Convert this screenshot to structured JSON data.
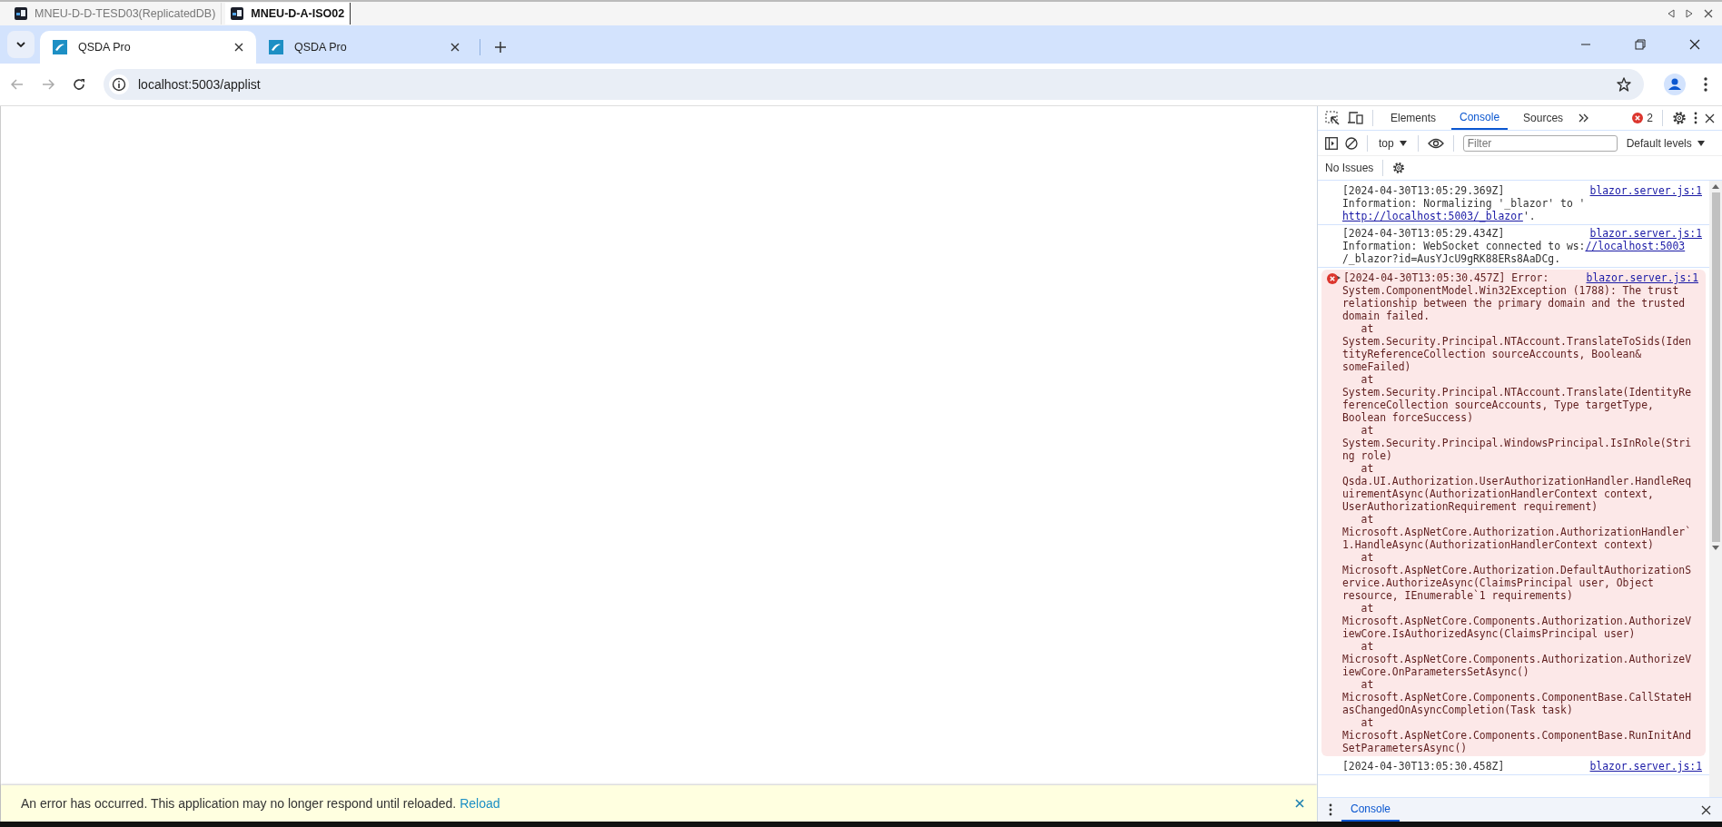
{
  "remote_tabs": [
    {
      "label": "MNEU-D-D-TESD03(ReplicatedDB)",
      "selected": false
    },
    {
      "label": "MNEU-D-A-ISO02",
      "selected": true
    }
  ],
  "browser": {
    "tabs": [
      {
        "title": "QSDA Pro",
        "selected": true
      },
      {
        "title": "QSDA Pro",
        "selected": false
      }
    ],
    "address": "localhost:5003/applist"
  },
  "page": {
    "error_banner": {
      "message": "An error has occurred. This application may no longer respond until reloaded.",
      "link": "Reload"
    }
  },
  "devtools": {
    "tabs": [
      {
        "label": "Elements",
        "selected": false
      },
      {
        "label": "Console",
        "selected": true
      },
      {
        "label": "Sources",
        "selected": false
      }
    ],
    "error_count": "2",
    "context": "top",
    "filter_placeholder": "Filter",
    "levels": "Default levels",
    "issues": "No Issues",
    "messages": [
      {
        "kind": "info",
        "header": "[2024-04-30T13:05:29.369Z]",
        "source": "blazor.server.js:1",
        "lines": [
          [
            {
              "kind": "text",
              "text": "Information: Normalizing '_blazor' to '"
            }
          ],
          [
            {
              "kind": "link",
              "text": "http://localhost:5003/_blazor"
            },
            {
              "kind": "text",
              "text": "'."
            }
          ]
        ]
      },
      {
        "kind": "info",
        "header": "[2024-04-30T13:05:29.434Z]",
        "source": "blazor.server.js:1",
        "lines": [
          [
            {
              "kind": "text",
              "text": "Information: WebSocket connected to ws:"
            },
            {
              "kind": "link",
              "text": "//localhost:5003"
            }
          ],
          [
            {
              "kind": "text",
              "text": "/_blazor?id=AusYJcU9gRK88ERs8AaDCg."
            }
          ]
        ]
      },
      {
        "kind": "error",
        "expanded": false,
        "header": "[2024-04-30T13:05:30.457Z] Error:",
        "source": "blazor.server.js:1",
        "lines": [
          [
            {
              "kind": "text",
              "text": "System.ComponentModel.Win32Exception (1788): The trust"
            }
          ],
          [
            {
              "kind": "text",
              "text": "relationship between the primary domain and the trusted"
            }
          ],
          [
            {
              "kind": "text",
              "text": "domain failed."
            }
          ],
          [
            {
              "kind": "text",
              "text": "   at"
            }
          ],
          [
            {
              "kind": "text",
              "text": "System.Security.Principal.NTAccount.TranslateToSids(Iden"
            }
          ],
          [
            {
              "kind": "text",
              "text": "tityReferenceCollection sourceAccounts, Boolean&"
            }
          ],
          [
            {
              "kind": "text",
              "text": "someFailed)"
            }
          ],
          [
            {
              "kind": "text",
              "text": "   at"
            }
          ],
          [
            {
              "kind": "text",
              "text": "System.Security.Principal.NTAccount.Translate(IdentityRe"
            }
          ],
          [
            {
              "kind": "text",
              "text": "ferenceCollection sourceAccounts, Type targetType,"
            }
          ],
          [
            {
              "kind": "text",
              "text": "Boolean forceSuccess)"
            }
          ],
          [
            {
              "kind": "text",
              "text": "   at"
            }
          ],
          [
            {
              "kind": "text",
              "text": "System.Security.Principal.WindowsPrincipal.IsInRole(Stri"
            }
          ],
          [
            {
              "kind": "text",
              "text": "ng role)"
            }
          ],
          [
            {
              "kind": "text",
              "text": "   at"
            }
          ],
          [
            {
              "kind": "text",
              "text": "Qsda.UI.Authorization.UserAuthorizationHandler.HandleReq"
            }
          ],
          [
            {
              "kind": "text",
              "text": "uirementAsync(AuthorizationHandlerContext context,"
            }
          ],
          [
            {
              "kind": "text",
              "text": "UserAuthorizationRequirement requirement)"
            }
          ],
          [
            {
              "kind": "text",
              "text": "   at"
            }
          ],
          [
            {
              "kind": "text",
              "text": "Microsoft.AspNetCore.Authorization.AuthorizationHandler`"
            }
          ],
          [
            {
              "kind": "text",
              "text": "1.HandleAsync(AuthorizationHandlerContext context)"
            }
          ],
          [
            {
              "kind": "text",
              "text": "   at"
            }
          ],
          [
            {
              "kind": "text",
              "text": "Microsoft.AspNetCore.Authorization.DefaultAuthorizationS"
            }
          ],
          [
            {
              "kind": "text",
              "text": "ervice.AuthorizeAsync(ClaimsPrincipal user, Object"
            }
          ],
          [
            {
              "kind": "text",
              "text": "resource, IEnumerable`1 requirements)"
            }
          ],
          [
            {
              "kind": "text",
              "text": "   at"
            }
          ],
          [
            {
              "kind": "text",
              "text": "Microsoft.AspNetCore.Components.Authorization.AuthorizeV"
            }
          ],
          [
            {
              "kind": "text",
              "text": "iewCore.IsAuthorizedAsync(ClaimsPrincipal user)"
            }
          ],
          [
            {
              "kind": "text",
              "text": "   at"
            }
          ],
          [
            {
              "kind": "text",
              "text": "Microsoft.AspNetCore.Components.Authorization.AuthorizeV"
            }
          ],
          [
            {
              "kind": "text",
              "text": "iewCore.OnParametersSetAsync()"
            }
          ],
          [
            {
              "kind": "text",
              "text": "   at"
            }
          ],
          [
            {
              "kind": "text",
              "text": "Microsoft.AspNetCore.Components.ComponentBase.CallStateH"
            }
          ],
          [
            {
              "kind": "text",
              "text": "asChangedOnAsyncCompletion(Task task)"
            }
          ],
          [
            {
              "kind": "text",
              "text": "   at"
            }
          ],
          [
            {
              "kind": "text",
              "text": "Microsoft.AspNetCore.Components.ComponentBase.RunInitAnd"
            }
          ],
          [
            {
              "kind": "text",
              "text": "SetParametersAsync()"
            }
          ]
        ]
      },
      {
        "kind": "info",
        "header": "[2024-04-30T13:05:30.458Z]",
        "source": "blazor.server.js:1"
      }
    ],
    "drawer_tab": "Console"
  }
}
